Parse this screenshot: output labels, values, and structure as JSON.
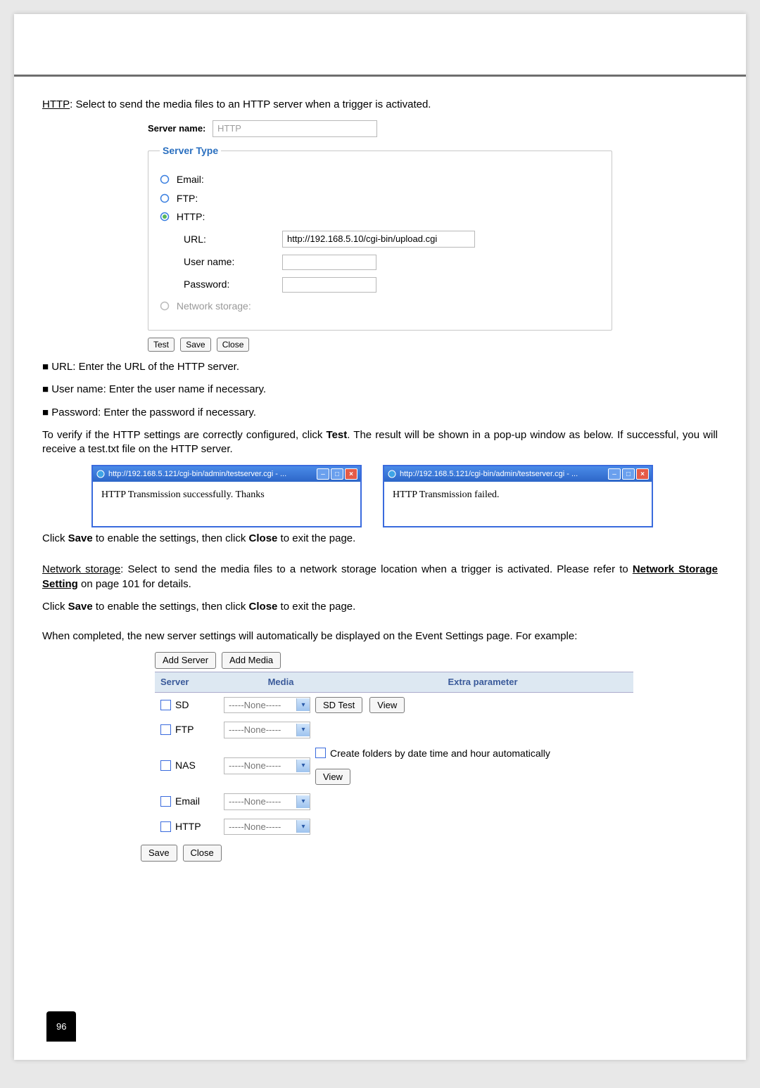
{
  "intro": "HTTP: Select to send the media files to an HTTP server when a trigger is activated.",
  "server_name_label": "Server name:",
  "server_name_value": "HTTP",
  "server_type_legend": "Server Type",
  "radios": {
    "email": "Email:",
    "ftp": "FTP:",
    "http": "HTTP:",
    "network": "Network storage:"
  },
  "http_fields": {
    "url_label": "URL:",
    "url_value": "http://192.168.5.10/cgi-bin/upload.cgi",
    "user_label": "User name:",
    "pass_label": "Password:"
  },
  "btns1": {
    "test": "Test",
    "save": "Save",
    "close": "Close"
  },
  "bullets": {
    "url": "■ URL: Enter the URL of the HTTP server.",
    "user": "■ User name: Enter the user name if necessary.",
    "pass": "■ Password: Enter the password if necessary."
  },
  "verify1": "To verify if the HTTP settings are correctly configured, click ",
  "verify_test": "Test",
  "verify2": ". The result will be shown in a pop-up window as below. If successful, you will receive a test.txt file on the HTTP server.",
  "popup_title": "http://192.168.5.121/cgi-bin/admin/testserver.cgi - ...",
  "popup_ok": "HTTP Transmission successfully. Thanks",
  "popup_fail": "HTTP Transmission failed.",
  "after_popup1a": "Click ",
  "after_popup1b": " to enable the settings, then click ",
  "after_popup1c": " to exit the page.",
  "save_word": "Save",
  "close_word": "Close",
  "net1a": "Network storage",
  "net1b": ": Select to send the media files to a network storage location when a trigger is activated. Please refer to ",
  "net1c": "Network Storage Setting",
  "net1d": " on page 101 for details.",
  "completed": "When completed, the new server settings will automatically be displayed on the Event Settings page. For example:",
  "btns2": {
    "add_server": "Add Server",
    "add_media": "Add Media"
  },
  "tbl_head": {
    "server": "Server",
    "media": "Media",
    "extra": "Extra parameter"
  },
  "sel_none": "-----None-----",
  "rows": {
    "sd": "SD",
    "ftp": "FTP",
    "nas": "NAS",
    "email": "Email",
    "http": "HTTP"
  },
  "extra": {
    "sd_test": "SD Test",
    "view": "View",
    "auto_folders": "Create folders by date time and hour automatically"
  },
  "btns3": {
    "save": "Save",
    "close": "Close"
  },
  "page_num": "96"
}
